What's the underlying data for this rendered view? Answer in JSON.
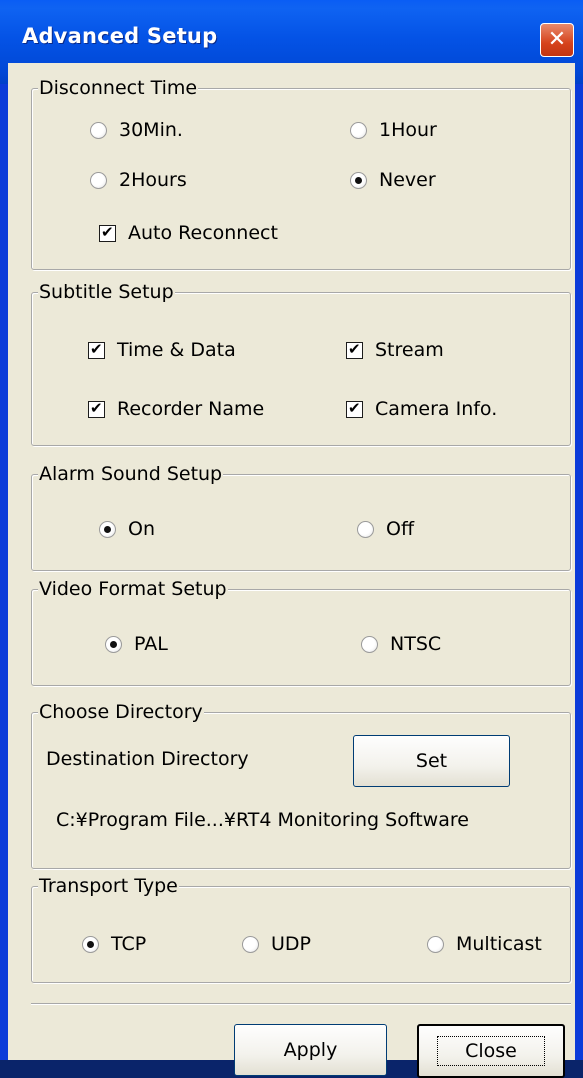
{
  "window": {
    "title": "Advanced Setup",
    "close_glyph": "✕"
  },
  "disconnect": {
    "legend": "Disconnect Time",
    "options": [
      {
        "label": "30Min.",
        "checked": false
      },
      {
        "label": "1Hour",
        "checked": false
      },
      {
        "label": "2Hours",
        "checked": false
      },
      {
        "label": "Never",
        "checked": true
      }
    ],
    "auto_reconnect": {
      "label": "Auto Reconnect",
      "checked": true
    }
  },
  "subtitle": {
    "legend": "Subtitle Setup",
    "items": [
      {
        "label": "Time & Data",
        "checked": true
      },
      {
        "label": "Stream",
        "checked": true
      },
      {
        "label": "Recorder Name",
        "checked": true
      },
      {
        "label": "Camera Info.",
        "checked": true
      }
    ]
  },
  "alarm": {
    "legend": "Alarm Sound Setup",
    "options": [
      {
        "label": "On",
        "checked": true
      },
      {
        "label": "Off",
        "checked": false
      }
    ]
  },
  "video": {
    "legend": "Video Format Setup",
    "options": [
      {
        "label": "PAL",
        "checked": true
      },
      {
        "label": "NTSC",
        "checked": false
      }
    ]
  },
  "directory": {
    "legend": "Choose Directory",
    "label": "Destination Directory",
    "set_button": "Set",
    "path": "C:¥Program File...¥RT4 Monitoring Software"
  },
  "transport": {
    "legend": "Transport Type",
    "options": [
      {
        "label": "TCP",
        "checked": true
      },
      {
        "label": "UDP",
        "checked": false
      },
      {
        "label": "Multicast",
        "checked": false
      }
    ]
  },
  "footer": {
    "apply": "Apply",
    "close": "Close"
  }
}
